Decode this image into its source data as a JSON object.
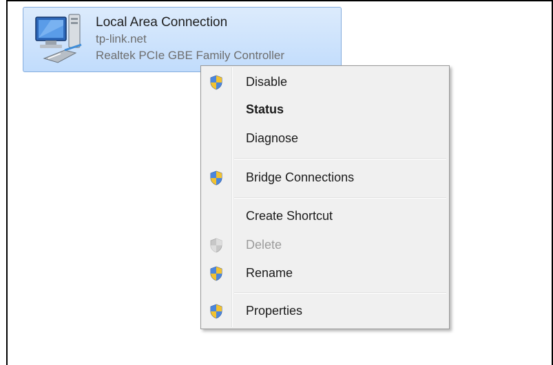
{
  "connection": {
    "name": "Local Area Connection",
    "network": "tp-link.net",
    "adapter": "Realtek PCIe GBE Family Controller",
    "icon": "network-computer-icon",
    "selected_color": "#c9e0fc"
  },
  "context_menu": {
    "items": [
      {
        "label": "Disable",
        "icon": "uac-shield-icon"
      },
      {
        "label": "Status",
        "icon": null,
        "default": true
      },
      {
        "label": "Diagnose",
        "icon": null
      },
      {
        "label": "Bridge Connections",
        "icon": "uac-shield-icon"
      },
      {
        "label": "Create Shortcut",
        "icon": null
      },
      {
        "label": "Delete",
        "icon": "uac-shield-icon",
        "disabled": true
      },
      {
        "label": "Rename",
        "icon": "uac-shield-icon"
      },
      {
        "label": "Properties",
        "icon": "uac-shield-icon"
      }
    ]
  }
}
